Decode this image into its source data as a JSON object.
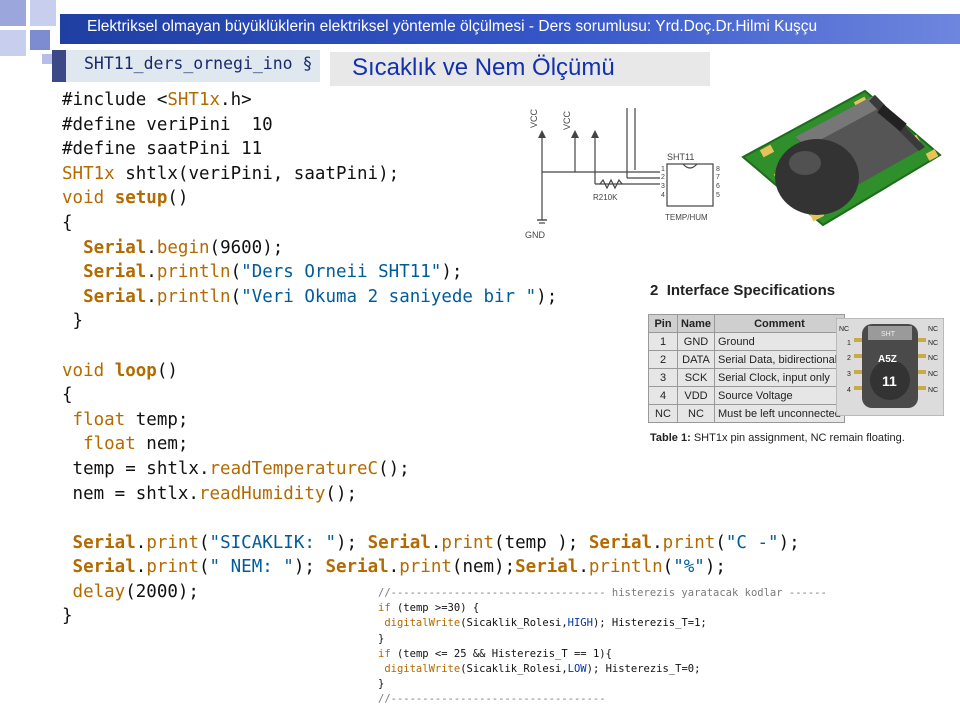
{
  "header": {
    "title": "Elektriksel olmayan büyüklüklerin elektriksel yöntemle ölçülmesi - Ders sorumlusu: Yrd.Doç.Dr.Hilmi Kuşçu"
  },
  "tab": {
    "label": "SHT11_ders_ornegi_ino §"
  },
  "slide_title": "Sıcaklık ve Nem Ölçümü",
  "code": {
    "l1a": "#include <",
    "l1b": "SHT1x",
    "l1c": ".h>",
    "l2": "#define veriPini  10",
    "l3": "#define saatPini 11",
    "l4a": "SHT1x",
    "l4b": " shtlx(veriPini, saatPini);",
    "l5a": "void ",
    "l5b": "setup",
    "l5c": "()",
    "l6": "{",
    "l7a": "  Serial",
    "l7b": ".",
    "l7c": "begin",
    "l7d": "(9600);",
    "l8a": "  Serial",
    "l8b": ".",
    "l8c": "println",
    "l8d": "(",
    "l8e": "\"Ders Orneii SHT11\"",
    "l8f": ");",
    "l9a": "  Serial",
    "l9b": ".",
    "l9c": "println",
    "l9d": "(",
    "l9e": "\"Veri Okuma 2 saniyede bir \"",
    "l9f": ");",
    "l10": " }",
    "l12a": "void ",
    "l12b": "loop",
    "l12c": "()",
    "l13": "{",
    "l14a": " float",
    "l14b": " temp;",
    "l15a": "  float",
    "l15b": " nem;",
    "l16a": " temp = shtlx.",
    "l16b": "readTemperatureC",
    "l16c": "();",
    "l17a": " nem = shtlx.",
    "l17b": "readHumidity",
    "l17c": "();",
    "l19a": " Serial",
    "l19b": ".",
    "l19c": "print",
    "l19d": "(",
    "l19e": "\"SICAKLIK: \"",
    "l19f": "); ",
    "l19g": "Serial",
    "l19h": ".",
    "l19i": "print",
    "l19j": "(temp ); ",
    "l19k": "Serial",
    "l19l": ".",
    "l19m": "print",
    "l19n": "(",
    "l19o": "\"C -\"",
    "l19p": ");",
    "l20a": " Serial",
    "l20b": ".",
    "l20c": "print",
    "l20d": "(",
    "l20e": "\" NEM: \"",
    "l20f": "); ",
    "l20g": "Serial",
    "l20h": ".",
    "l20i": "print",
    "l20j": "(nem);",
    "l20k": "Serial",
    "l20l": ".",
    "l20m": "println",
    "l20n": "(",
    "l20o": "\"%\"",
    "l20p": ");",
    "l21a": " delay",
    "l21b": "(2000);",
    "l22": "}"
  },
  "hysteresis": {
    "h1": "//---------------------------------- histerezis yaratacak kodlar ------",
    "h2a": "if",
    "h2b": " (temp >=30) {",
    "h3a": "digitalWrite",
    "h3b": "(Sicaklik_Rolesi,",
    "h3c": "HIGH",
    "h3d": "); Histerezis_T=1;",
    "h4": "}",
    "h5a": "if",
    "h5b": " (temp <= 25 && Histerezis_T == 1){",
    "h6a": "digitalWrite",
    "h6b": "(Sicaklik_Rolesi,",
    "h6c": "LOW",
    "h6d": "); Histerezis_T=0;",
    "h7": "}",
    "h8": "//----------------------------------"
  },
  "schematic": {
    "vcc": "VCC",
    "chip": "SHT11",
    "resistor": "R210K",
    "gnd": "GND",
    "label": "TEMP/HUM",
    "pins_left": [
      "1",
      "2",
      "3",
      "4"
    ],
    "pins_right": [
      "8",
      "7",
      "6",
      "5"
    ]
  },
  "sensor_photo": {
    "mark": "SHT"
  },
  "spec": {
    "section": "2",
    "title": "Interface Specifications",
    "columns": [
      "Pin",
      "Name",
      "Comment"
    ],
    "rows": [
      [
        "1",
        "GND",
        "Ground"
      ],
      [
        "2",
        "DATA",
        "Serial Data, bidirectional"
      ],
      [
        "3",
        "SCK",
        "Serial Clock, input only"
      ],
      [
        "4",
        "VDD",
        "Source Voltage"
      ],
      [
        "NC",
        "NC",
        "Must be left unconnected"
      ]
    ],
    "caption_bold": "Table 1:",
    "caption_rest": " SHT1x pin assignment, NC remain floating.",
    "package": {
      "nc": "NC",
      "pins": [
        "1",
        "2",
        "3",
        "4"
      ],
      "code": "A5Z",
      "num": "11",
      "mark": "SHT"
    }
  }
}
